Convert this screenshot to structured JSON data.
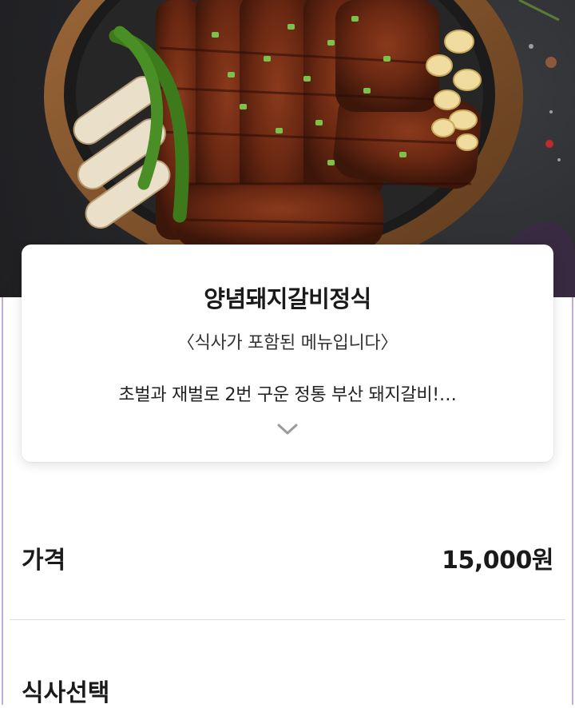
{
  "menu": {
    "name": "양념돼지갈비정식",
    "note": "〈식사가 포함된 메뉴입니다〉",
    "description": "초벌과 재벌로 2번 구운 정통 부산 돼지갈비!…"
  },
  "price": {
    "label": "가격",
    "value": "15,000원"
  },
  "meal_section": {
    "title": "식사선택"
  },
  "icons": {
    "expand": "chevron-down-icon"
  },
  "colors": {
    "accent_side": "#8a6bb8",
    "card_bg": "#ffffff",
    "text": "#1a1a1a"
  }
}
